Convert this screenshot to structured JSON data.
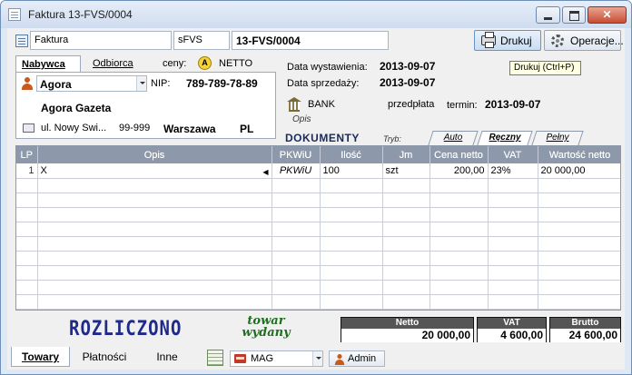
{
  "window": {
    "title": "Faktura 13-FVS/0004",
    "close_glyph": "✕"
  },
  "toolbar": {
    "doc_type": "Faktura",
    "series": "sFVS",
    "number": "13-FVS/0004",
    "print_label": "Drukuj",
    "operations_label": "Operacje...",
    "print_tooltip": "Drukuj (Ctrl+P)"
  },
  "buyer_panel": {
    "tab_buyer": "Nabywca",
    "tab_recipient": "Odbiorca",
    "ceny_label": "ceny:",
    "ceny_icon": "A",
    "ceny_value": "NETTO",
    "buyer_code": "Agora",
    "nip_label": "NIP:",
    "nip": "789-789-78-89",
    "buyer_name": "Agora Gazeta",
    "street": "ul. Nowy Swi...",
    "postcode": "99-999",
    "city": "Warszawa",
    "country": "PL"
  },
  "dates": {
    "issue_label": "Data wystawienia:",
    "issue_date": "2013-09-07",
    "sale_label": "Data sprzedaży:",
    "sale_date": "2013-09-07"
  },
  "payment": {
    "method": "BANK",
    "type": "przedpłata",
    "term_label": "termin:",
    "term_date": "2013-09-07",
    "opis_label": "Opis"
  },
  "documents": {
    "label": "DOKUMENTY",
    "mode_label": "Tryb:",
    "tabs": [
      "Auto",
      "Ręczny",
      "Pełny"
    ]
  },
  "grid": {
    "columns": [
      "LP",
      "Opis",
      "PKWiU",
      "Ilość",
      "Jm",
      "Cena netto",
      "VAT",
      "Wartość netto"
    ],
    "rows": [
      {
        "lp": "1",
        "opis": "X",
        "pkwiu": "PKWiU",
        "ilosc": "100",
        "jm": "szt",
        "cena": "200,00",
        "vat": "23%",
        "wartosc": "20 000,00"
      }
    ]
  },
  "stamps": {
    "settled": "ROZLICZONO",
    "goods_issued": "towar wydany"
  },
  "totals": {
    "netto_label": "Netto",
    "netto": "20 000,00",
    "vat_label": "VAT",
    "vat": "4 600,00",
    "brutto_label": "Brutto",
    "brutto": "24 600,00"
  },
  "bottom": {
    "tabs": [
      "Towary",
      "Płatności",
      "Inne"
    ],
    "warehouse": "MAG",
    "user": "Admin"
  }
}
